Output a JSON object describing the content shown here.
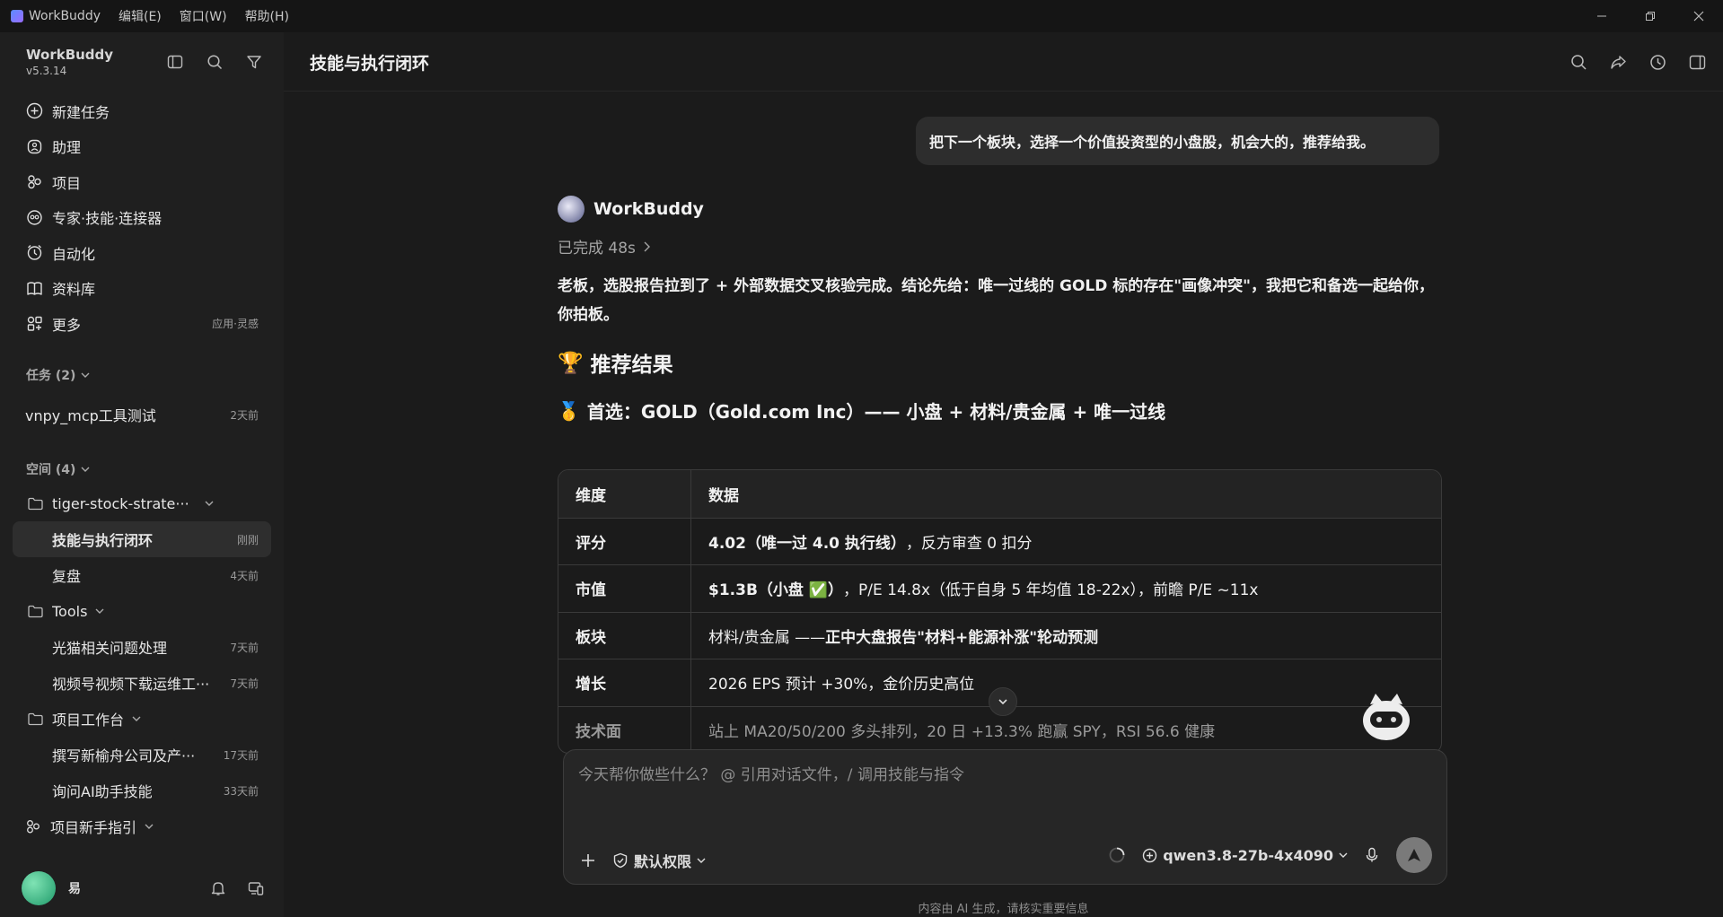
{
  "titlebar": {
    "app_name": "WorkBuddy",
    "menu": [
      "编辑(E)",
      "窗口(W)",
      "帮助(H)"
    ]
  },
  "sidebar": {
    "app_name": "WorkBuddy",
    "version": "v5.3.14",
    "nav": [
      {
        "label": "新建任务",
        "icon": "plus-circle-icon"
      },
      {
        "label": "助理",
        "icon": "assistant-icon"
      },
      {
        "label": "项目",
        "icon": "project-icon"
      },
      {
        "label": "专家·技能·连接器",
        "icon": "expert-icon"
      },
      {
        "label": "自动化",
        "icon": "automation-icon"
      },
      {
        "label": "资料库",
        "icon": "library-icon"
      },
      {
        "label": "更多",
        "icon": "more-icon",
        "hint": "应用·灵感"
      }
    ],
    "tasks_title": "任务 (2)",
    "tasks": [
      {
        "label": "vnpy_mcp工具测试",
        "time": "2天前"
      }
    ],
    "spaces_title": "空间 (4)",
    "spaces": [
      {
        "folder": "tiger-stock-strate···",
        "items": [
          {
            "label": "技能与执行闭环",
            "time": "刚刚",
            "active": true
          },
          {
            "label": "复盘",
            "time": "4天前"
          }
        ]
      },
      {
        "folder": "Tools",
        "items": [
          {
            "label": "光猫相关问题处理",
            "time": "7天前"
          },
          {
            "label": "视频号视频下载运维工···",
            "time": "7天前"
          }
        ]
      },
      {
        "folder": "项目工作台",
        "items": [
          {
            "label": "撰写新榆舟公司及产···",
            "time": "17天前"
          },
          {
            "label": "询问AI助手技能",
            "time": "33天前"
          }
        ]
      }
    ],
    "guide": "项目新手指引",
    "user_name": "易"
  },
  "main": {
    "title": "技能与执行闭环",
    "user_message": "把下一个板块，选择一个价值投资型的小盘股，机会大的，推荐给我。",
    "bot_name": "WorkBuddy",
    "status": "已完成 48s",
    "intro": "老板，选股报告拉到了 + 外部数据交叉核验完成。结论先给：唯一过线的 GOLD 标的存在\"画像冲突\"，我把它和备选一起给你，你拍板。",
    "h2_emoji": "🏆",
    "h2": "推荐结果",
    "h3_emoji": "🥇",
    "h3": "首选：GOLD（Gold.com Inc）—— 小盘 + 材料/贵金属 + 唯一过线",
    "table": {
      "headers": [
        "维度",
        "数据"
      ],
      "rows": [
        {
          "k": "评分",
          "bold": "4.02（唯一过 4.0 执行线）",
          "rest": "，反方审查 0 扣分"
        },
        {
          "k": "市值",
          "bold": "$1.3B（小盘 ✅）",
          "rest": "，P/E 14.8x（低于自身 5 年均值 18-22x），前瞻 P/E ~11x"
        },
        {
          "k": "板块",
          "pre": "材料/贵金属 —— ",
          "bold": "正中大盘报告\"材料+能源补涨\"轮动预测",
          "rest": ""
        },
        {
          "k": "增长",
          "bold": "",
          "rest": "2026 EPS 预计 +30%，金价历史高位"
        },
        {
          "k": "技术面",
          "bold": "",
          "rest": "站上 MA20/50/200 多头排列，20 日 +13.3% 跑赢 SPY，RSI 56.6 健康"
        }
      ]
    },
    "composer": {
      "placeholder": "今天帮你做些什么？ @ 引用对话文件，/ 调用技能与指令",
      "permission": "默认权限",
      "model": "qwen3.8-27b-4x4090"
    },
    "disclaimer": "内容由 AI 生成，请核实重要信息"
  }
}
